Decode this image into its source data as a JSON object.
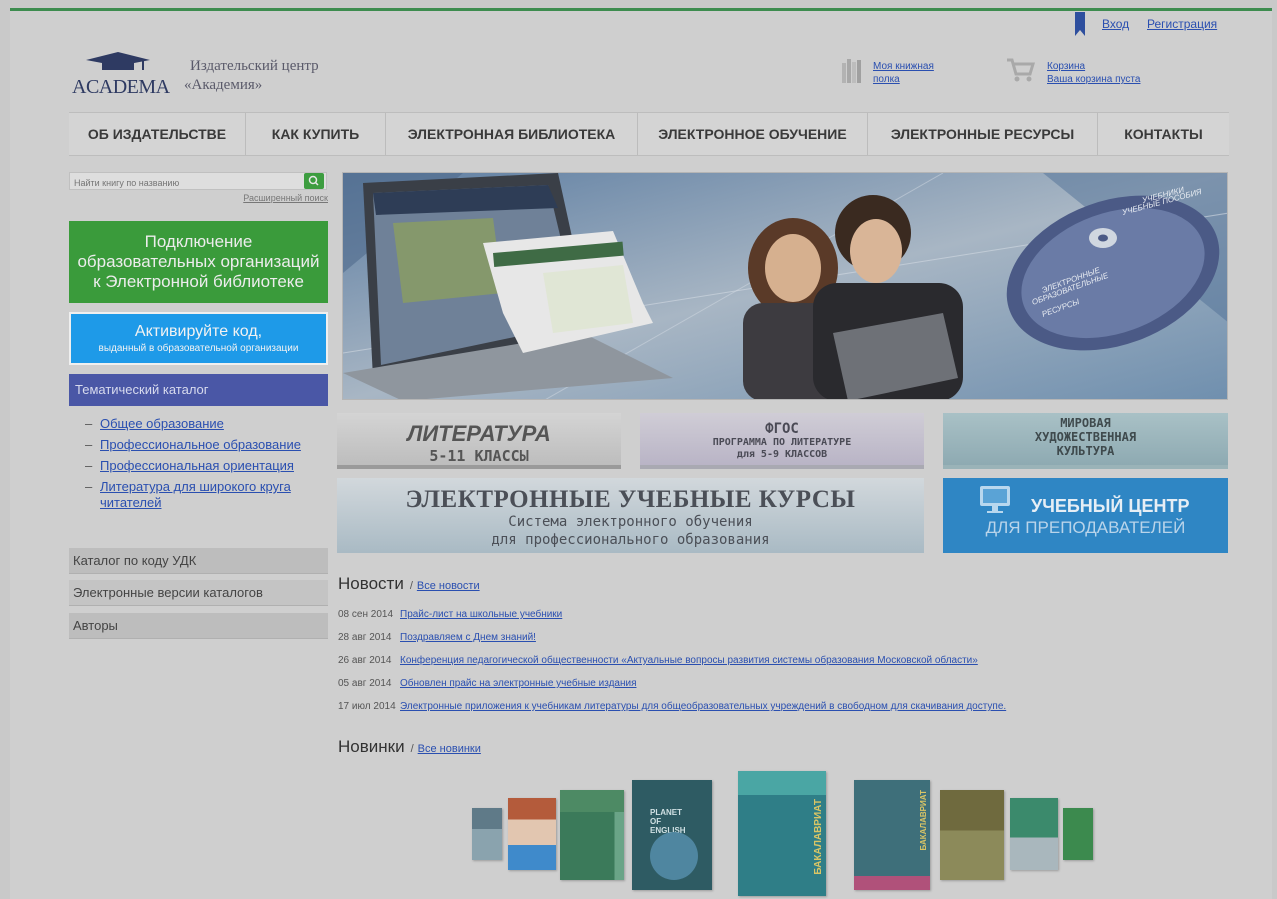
{
  "header": {
    "login": "Вход",
    "register": "Регистрация",
    "logo_text": "ACADEMA",
    "publisher_line1": "Издательский центр",
    "publisher_line2": "«Академия»",
    "shelf_link_l1": "Моя книжная",
    "shelf_link_l2": "полка",
    "cart_label": "Корзина",
    "cart_status": "Ваша корзина пуста"
  },
  "nav": [
    "ОБ ИЗДАТЕЛЬСТВЕ",
    "КАК КУПИТЬ",
    "ЭЛЕКТРОННАЯ БИБЛИОТЕКА",
    "ЭЛЕКТРОННОЕ ОБУЧЕНИЕ",
    "ЭЛЕКТРОННЫЕ РЕСУРСЫ",
    "КОНТАКТЫ"
  ],
  "sidebar": {
    "search_placeholder": "Найти книгу по названию",
    "advanced_search": "Расширенный поиск",
    "connect_l1": "Подключение",
    "connect_l2": "образовательных организаций",
    "connect_l3": "к Электронной библиотеке",
    "activate_l1": "Активируйте код,",
    "activate_l2": "выданный в образовательной организации",
    "catalog_title": "Тематический каталог",
    "catalog_items": [
      "Общее образование",
      "Профессиональное образование",
      "Профессиональная ориентация",
      "Литература для широкого круга читателей"
    ],
    "udk": "Каталог по коду УДК",
    "catalogs": "Электронные версии каталогов",
    "authors": "Авторы"
  },
  "banner": {
    "disc_line1": "УЧЕБНИКИ",
    "disc_line2": "УЧЕБНЫЕ ПОСОБИЯ",
    "disc_line3": "ЭЛЕКТРОННЫЕ",
    "disc_line4": "ОБРАЗОВАТЕЛЬНЫЕ",
    "disc_line5": "РЕСУРСЫ"
  },
  "promos": {
    "lit_title": "ЛИТЕРАТУРА",
    "lit_sub": "5-11 КЛАССЫ",
    "fgos_title": "ФГОС",
    "fgos_sub1": "ПРОГРАММА ПО ЛИТЕРАТУРЕ",
    "fgos_sub2": "для 5-9 КЛАССОВ",
    "mhk_l1": "МИРОВАЯ",
    "mhk_l2": "ХУДОЖЕСТВЕННАЯ",
    "mhk_l3": "КУЛЬТУРА",
    "courses_title": "ЭЛЕКТРОННЫЕ УЧЕБНЫЕ КУРСЫ",
    "courses_sub1": "Система электронного обучения",
    "courses_sub2": "для профессионального образования",
    "center_l1": "УЧЕБНЫЙ ЦЕНТР",
    "center_l2": "ДЛЯ ПРЕПОДАВАТЕЛЕЙ"
  },
  "news": {
    "title": "Новости",
    "all_link": "Все новости",
    "items": [
      {
        "date": "08 сен 2014",
        "text": "Прайс-лист на школьные учебники"
      },
      {
        "date": "28 авг 2014",
        "text": "Поздравляем с Днем знаний!"
      },
      {
        "date": "26 авг 2014",
        "text": "Конференция педагогической общественности «Актуальные вопросы развития системы образования Московской области»"
      },
      {
        "date": "05 авг 2014",
        "text": "Обновлен прайс на электронные учебные издания"
      },
      {
        "date": "17 июл 2014",
        "text": "Электронные приложения к учебникам литературы для общеобразовательных учреждений в свободном для скачивания доступе."
      }
    ]
  },
  "novelties": {
    "title": "Новинки",
    "all_link": "Все новинки",
    "book_label_planet": "PLANET OF ENGLISH",
    "book_label_bakalavriat": "БАКАЛАВРИАТ"
  },
  "colors": {
    "green": "#3a9b3b",
    "blue": "#1e9ae8",
    "catalog": "#4a57a6",
    "link": "#2a4fb0"
  }
}
